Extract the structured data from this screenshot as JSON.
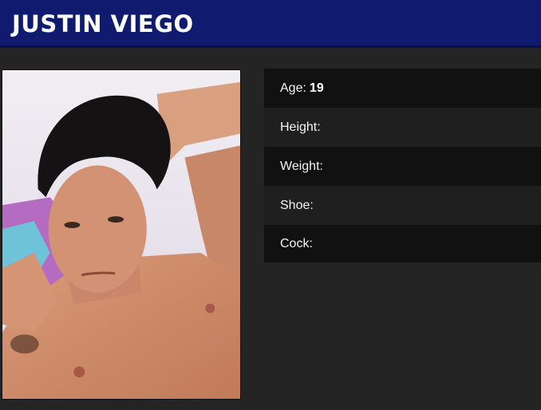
{
  "model": {
    "name": "JUSTIN VIEGO"
  },
  "stats": [
    {
      "label": "Age:",
      "value": "19"
    },
    {
      "label": "Height:",
      "value": ""
    },
    {
      "label": "Weight:",
      "value": ""
    },
    {
      "label": "Shoe:",
      "value": ""
    },
    {
      "label": "Cock:",
      "value": ""
    }
  ],
  "colors": {
    "header_bg": "#101a6e",
    "page_bg": "#242424",
    "row_dark": "#111111",
    "row_light": "#1f1f1f"
  }
}
